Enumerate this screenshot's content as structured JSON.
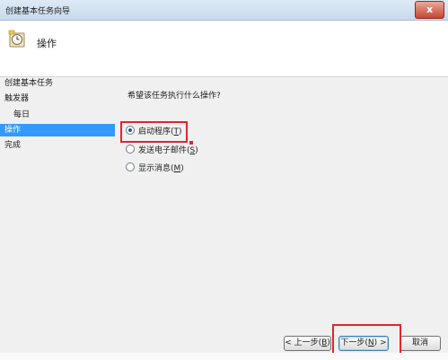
{
  "window": {
    "title": "创建基本任务向导",
    "close_glyph": "x"
  },
  "header": {
    "title": "操作",
    "icon": "clock-scheduler-icon"
  },
  "sidebar": {
    "steps": [
      {
        "label": "创建基本任务",
        "active": false
      },
      {
        "label": "触发器",
        "active": false
      },
      {
        "label": "每日",
        "active": false
      },
      {
        "label": "操作",
        "active": true
      },
      {
        "label": "完成",
        "active": false
      }
    ]
  },
  "content": {
    "question": "希望该任务执行什么操作?",
    "options": [
      {
        "label": "启动程序(",
        "hotkey": "T",
        "suffix": ")",
        "checked": true
      },
      {
        "label": "发送电子邮件(",
        "hotkey": "S",
        "suffix": ")",
        "checked": false
      },
      {
        "label": "显示消息(",
        "hotkey": "M",
        "suffix": ")",
        "checked": false
      }
    ]
  },
  "buttons": {
    "back": {
      "label": "< 上一步(",
      "hotkey": "B",
      "suffix": ")"
    },
    "next": {
      "label": "下一步(",
      "hotkey": "N",
      "suffix": ") >"
    },
    "cancel": {
      "label": "取消"
    }
  },
  "colors": {
    "highlight": "#3399ff",
    "annotation_red": "#e0262d"
  }
}
